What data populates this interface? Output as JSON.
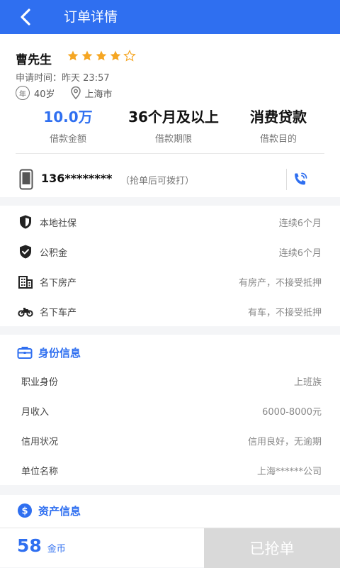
{
  "header": {
    "title": "订单详情"
  },
  "profile": {
    "name": "曹先生",
    "rating": 4,
    "rating_max": 5,
    "apply_label": "申请时间：",
    "apply_time": "昨天 23:57",
    "age_icon_text": "年",
    "age": "40岁",
    "city": "上海市"
  },
  "stats": [
    {
      "value": "10.0万",
      "label": "借款金额"
    },
    {
      "value": "36个月及以上",
      "label": "借款期限"
    },
    {
      "value": "消费贷款",
      "label": "借款目的"
    }
  ],
  "phone": {
    "number": "136********",
    "tip": "（抢单后可拨打）"
  },
  "assets": [
    {
      "icon": "shield-icon",
      "label": "本地社保",
      "value": "连续6个月"
    },
    {
      "icon": "shield-check-icon",
      "label": "公积金",
      "value": "连续6个月"
    },
    {
      "icon": "building-icon",
      "label": "名下房产",
      "value": "有房产，不接受抵押"
    },
    {
      "icon": "motorbike-icon",
      "label": "名下车产",
      "value": "有车，不接受抵押"
    }
  ],
  "identity": {
    "title": "身份信息",
    "rows": [
      {
        "label": "职业身份",
        "value": "上班族"
      },
      {
        "label": "月收入",
        "value": "6000-8000元"
      },
      {
        "label": "信用状况",
        "value": "信用良好，无逾期"
      },
      {
        "label": "单位名称",
        "value": "上海******公司"
      }
    ]
  },
  "asset_info": {
    "title": "资产信息"
  },
  "footer": {
    "coins": "58",
    "coins_unit": "金币",
    "action": "已抢单"
  },
  "colors": {
    "primary": "#2f6ff0",
    "star": "#f5a623",
    "disabled": "#d9d9d9"
  }
}
